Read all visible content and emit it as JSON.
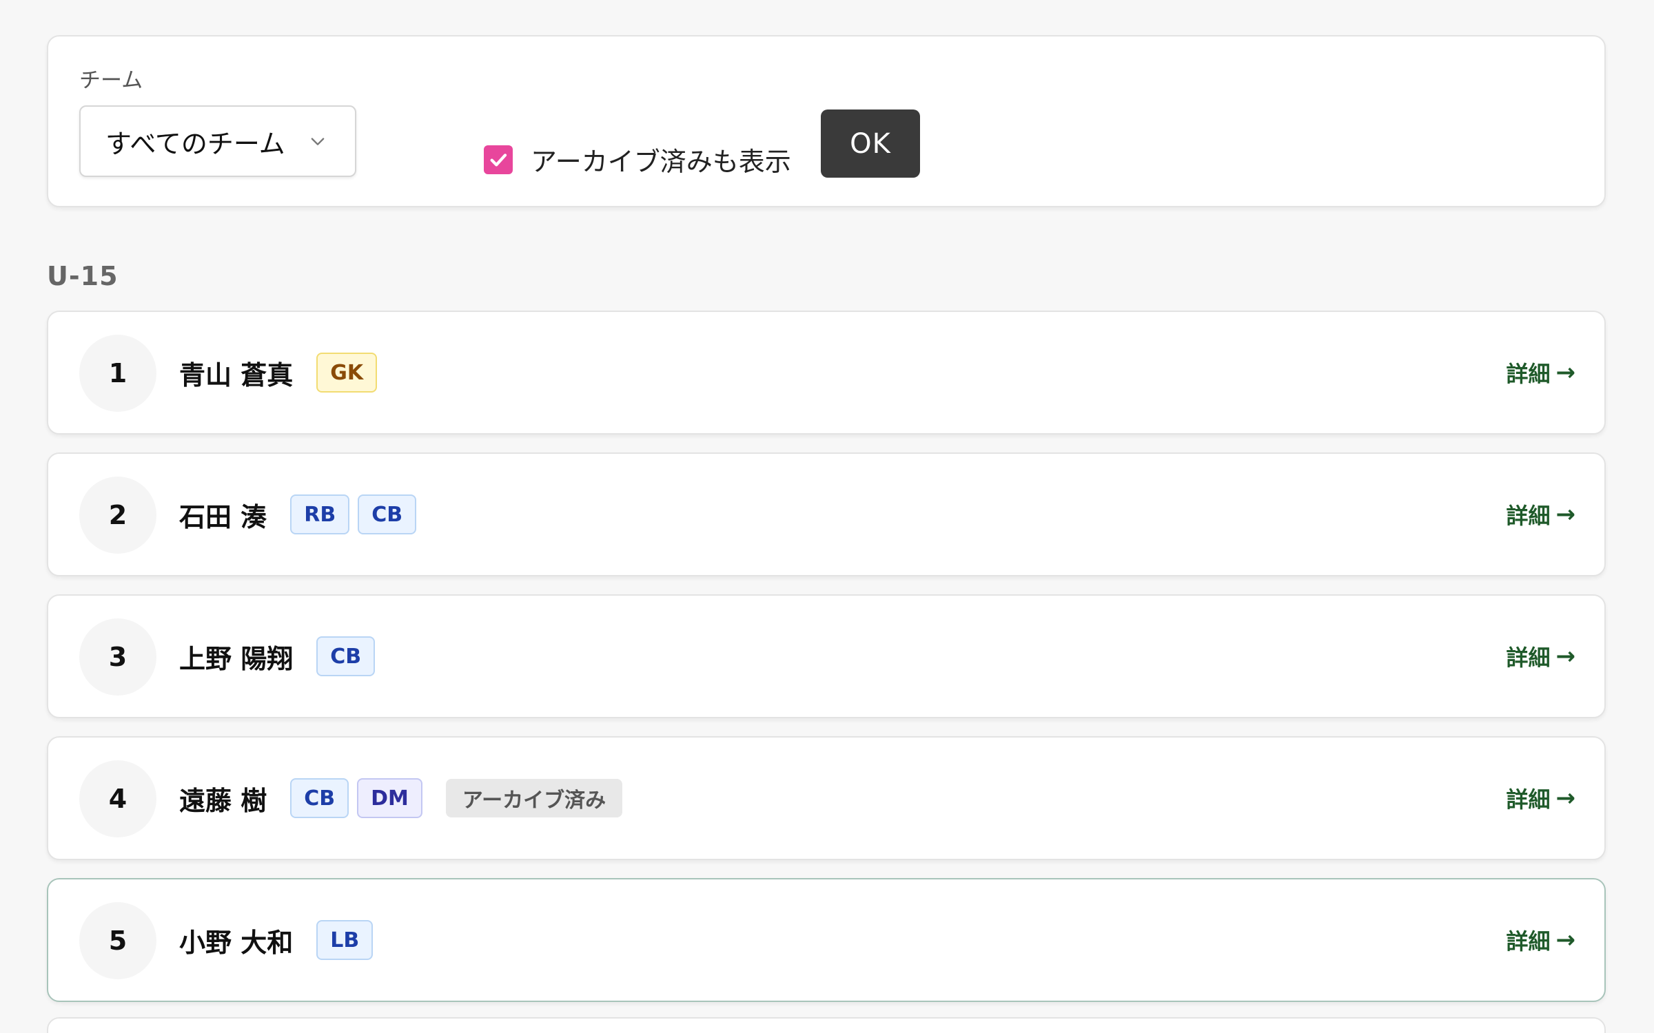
{
  "filter": {
    "team_label": "チーム",
    "team_select_value": "すべてのチーム",
    "show_archived_label": "アーカイブ済みも表示",
    "show_archived_checked": true,
    "ok_label": "OK"
  },
  "group": {
    "title": "U-15"
  },
  "players": [
    {
      "number": "1",
      "name": "青山 蒼真",
      "positions": [
        {
          "code": "GK",
          "kind": "gk"
        }
      ],
      "archived": false,
      "detail_label": "詳細",
      "arrow": "→"
    },
    {
      "number": "2",
      "name": "石田 湊",
      "positions": [
        {
          "code": "RB",
          "kind": "df"
        },
        {
          "code": "CB",
          "kind": "df"
        }
      ],
      "archived": false,
      "detail_label": "詳細",
      "arrow": "→"
    },
    {
      "number": "3",
      "name": "上野 陽翔",
      "positions": [
        {
          "code": "CB",
          "kind": "df"
        }
      ],
      "archived": false,
      "detail_label": "詳細",
      "arrow": "→"
    },
    {
      "number": "4",
      "name": "遠藤 樹",
      "positions": [
        {
          "code": "CB",
          "kind": "df"
        },
        {
          "code": "DM",
          "kind": "mf"
        }
      ],
      "archived": true,
      "archived_label": "アーカイブ済み",
      "detail_label": "詳細",
      "arrow": "→"
    },
    {
      "number": "5",
      "name": "小野 大和",
      "positions": [
        {
          "code": "LB",
          "kind": "df"
        }
      ],
      "archived": false,
      "detail_label": "詳細",
      "arrow": "→",
      "active": true
    }
  ],
  "colors": {
    "checkbox": "#e8469c",
    "ok_button": "#3a3a3a",
    "detail_link": "#1f5a2a"
  }
}
